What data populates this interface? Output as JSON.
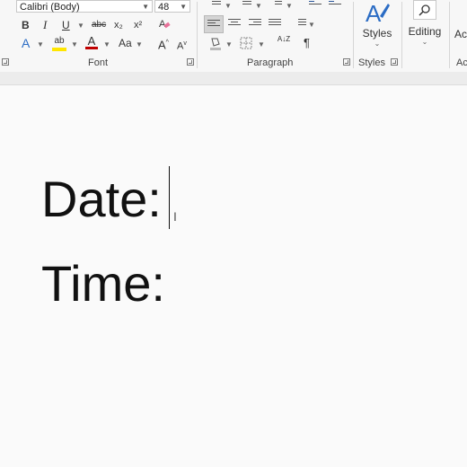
{
  "ribbon": {
    "font": {
      "name": "Calibri (Body)",
      "size": "48",
      "bold": "B",
      "italic": "I",
      "underline": "U",
      "strikethrough": "abc",
      "subscript": "x₂",
      "superscript": "x²",
      "grow": "A",
      "shrink": "A",
      "change_case": "Aa",
      "highlight": "ab",
      "font_color": "A",
      "text_effects": "A",
      "group_label": "Font"
    },
    "paragraph": {
      "group_label": "Paragraph",
      "sort": "A↓Z",
      "pilcrow": "¶"
    },
    "styles": {
      "label": "Styles",
      "group_label": "Styles"
    },
    "editing": {
      "label": "Editing"
    },
    "cut_off": {
      "top_right": "Ac",
      "bottom_right": "Ac"
    },
    "colors": {
      "highlight": "#ffe600",
      "font_color": "#c00000",
      "text_effects": "#2b6cc4",
      "accent": "#2b579a"
    }
  },
  "document": {
    "line1": "Date:",
    "line2": "Time:"
  }
}
